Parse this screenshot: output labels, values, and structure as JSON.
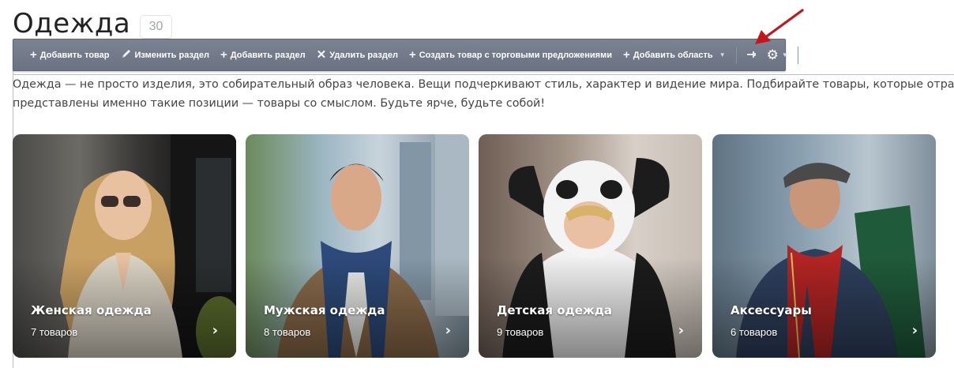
{
  "header": {
    "title": "Одежда",
    "count": "30"
  },
  "toolbar": {
    "buttons": [
      {
        "label": "Добавить товар",
        "icon": "plus-icon"
      },
      {
        "label": "Изменить раздел",
        "icon": "pencil-icon"
      },
      {
        "label": "Добавить раздел",
        "icon": "plus-icon"
      },
      {
        "label": "Удалить раздел",
        "icon": "x-icon"
      },
      {
        "label": "Создать товар с торговыми предложениями",
        "icon": "plus-icon"
      },
      {
        "label": "Добавить область",
        "icon": "plus-icon",
        "dropdown": true
      }
    ],
    "pin_icon": "pin-icon",
    "settings_icon": "gear-icon",
    "color": "#737b8b"
  },
  "annotation": {
    "arrow_color": "#c4161c"
  },
  "description": {
    "line1": "Одежда — не просто изделия, это собирательный образ человека. Вещи подчеркивают стиль, характер и видение мира. Подбирайте товары, которые отражают",
    "line2": "представлены именно такие позиции — товары со смыслом. Будьте ярче, будьте собой!"
  },
  "categories": [
    {
      "title": "Женская одежда",
      "count": "7 товаров"
    },
    {
      "title": "Мужская одежда",
      "count": "8 товаров"
    },
    {
      "title": "Детская одежда",
      "count": "9 товаров"
    },
    {
      "title": "Аксессуары",
      "count": "6 товаров"
    }
  ]
}
